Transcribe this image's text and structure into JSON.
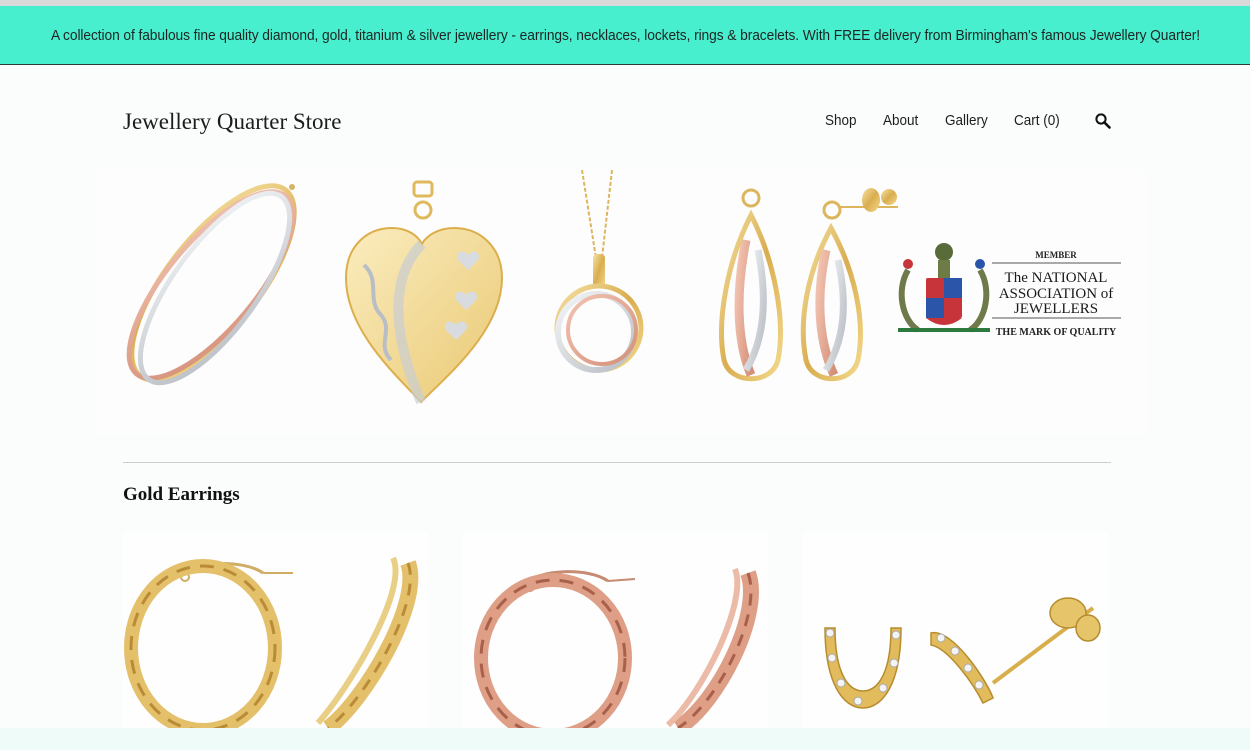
{
  "announcement": {
    "text": "A collection of fabulous fine quality diamond, gold, titanium & silver jewellery - earrings, necklaces, lockets, rings & bracelets. With FREE delivery from Birmingham's famous Jewellery Quarter!"
  },
  "header": {
    "store_title": "Jewellery Quarter Store",
    "nav": [
      {
        "label": "Shop"
      },
      {
        "label": "About"
      },
      {
        "label": "Gallery"
      },
      {
        "label": "Cart (0)"
      }
    ],
    "search_icon": "search-icon"
  },
  "banner": {
    "badge": {
      "member": "MEMBER",
      "line1": "The NATIONAL",
      "line2": "ASSOCIATION of",
      "line3": "JEWELLERS",
      "tagline": "THE MARK OF QUALITY"
    }
  },
  "section": {
    "title": "Gold Earrings"
  },
  "colors": {
    "announcement_bg": "#48efcf",
    "gold": "#e0b95c",
    "rose": "#d99a85",
    "silver": "#c8ccd2"
  }
}
